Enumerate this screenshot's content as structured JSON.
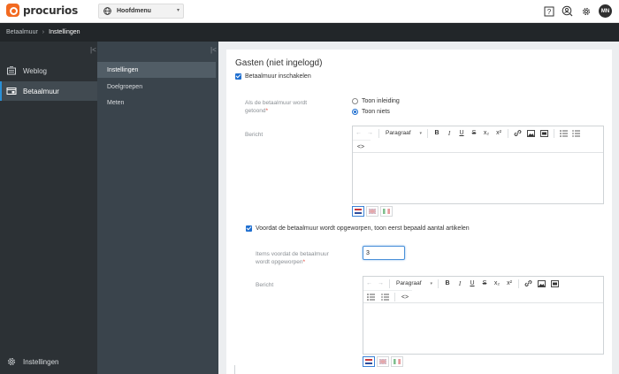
{
  "app": {
    "logo_text": "procurios"
  },
  "topbar": {
    "menu_label": "Hoofdmenu",
    "avatar": "MN"
  },
  "breadcrumb": {
    "items": [
      "Betaalmuur",
      "Instellingen"
    ],
    "separator": "›"
  },
  "leftnav": {
    "items": [
      {
        "label": "Weblog",
        "icon": "weblog-icon"
      },
      {
        "label": "Betaalmuur",
        "icon": "paywall-icon"
      }
    ],
    "footer": {
      "label": "Instellingen",
      "icon": "gear-icon"
    }
  },
  "subnav": {
    "items": [
      "Instellingen",
      "Doelgroepen",
      "Meten"
    ],
    "active": "Instellingen"
  },
  "main": {
    "title": "Gasten (niet ingelogd)",
    "enable_label": "Betaalmuur inschakelen",
    "shown_label_1": "Als de betaalmuur wordt",
    "shown_label_2": "getoond",
    "required_mark": "*",
    "options": [
      "Toon inleiding",
      "Toon niets"
    ],
    "message_label": "Bericht",
    "paragraph_label": "Paragraaf",
    "articles_check_label": "Voordat de betaalmuur wordt opgeworpen, toon eerst bepaald aantal artikelen",
    "items_label_1": "Items voordat de betaalmuur",
    "items_label_2": "wordt opgeworpen",
    "items_value": "3",
    "message_label_2": "Bericht"
  },
  "toolbar": {
    "bold": "B",
    "italic": "I",
    "underline": "U",
    "strike": "S",
    "subscript": "x₂",
    "superscript": "x²",
    "code": "<>"
  }
}
